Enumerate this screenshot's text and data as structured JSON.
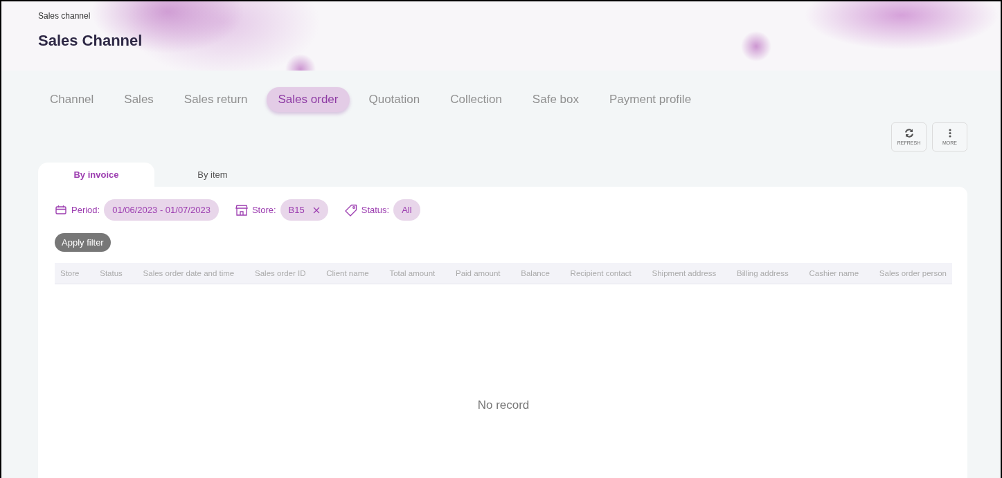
{
  "header": {
    "breadcrumb": "Sales channel",
    "title": "Sales Channel"
  },
  "tabs": [
    {
      "label": "Channel",
      "selected": false
    },
    {
      "label": "Sales",
      "selected": false
    },
    {
      "label": "Sales return",
      "selected": false
    },
    {
      "label": "Sales order",
      "selected": true
    },
    {
      "label": "Quotation",
      "selected": false
    },
    {
      "label": "Collection",
      "selected": false
    },
    {
      "label": "Safe box",
      "selected": false
    },
    {
      "label": "Payment profile",
      "selected": false
    }
  ],
  "actions": [
    {
      "kind": "refresh",
      "label": "REFRESH"
    },
    {
      "kind": "more",
      "label": "MORE"
    }
  ],
  "subtabs": [
    {
      "label": "By invoice",
      "selected": true
    },
    {
      "label": "By item",
      "selected": false
    }
  ],
  "filters": [
    {
      "kind": "period",
      "label": "Period:",
      "value": "01/06/2023 - 01/07/2023",
      "removable": false
    },
    {
      "kind": "store",
      "label": "Store:",
      "value": "B15",
      "removable": true
    },
    {
      "kind": "status",
      "label": "Status:",
      "value": "All",
      "removable": false
    }
  ],
  "apply_button": "Apply filter",
  "table": {
    "columns": [
      "Store",
      "Status",
      "Sales order date and time",
      "Sales order ID",
      "Client name",
      "Total amount",
      "Paid amount",
      "Balance",
      "Recipient contact",
      "Shipment address",
      "Billing address",
      "Cashier name",
      "Sales order person"
    ],
    "empty_message": "No record"
  }
}
